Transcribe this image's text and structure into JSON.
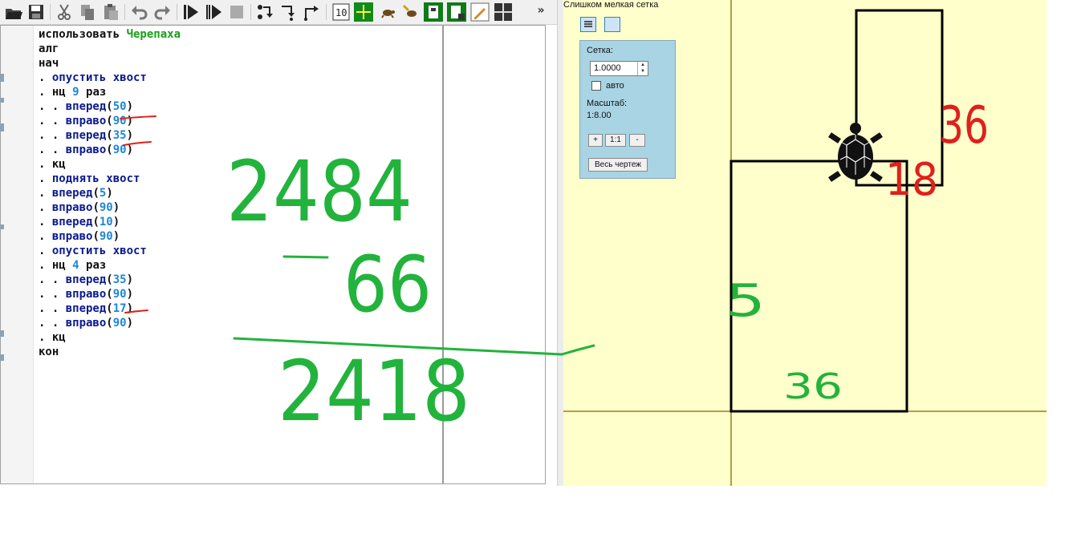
{
  "toolbar": {
    "buttons": [
      "open-icon",
      "save-icon",
      "cut-icon",
      "copy-icon",
      "paste-icon",
      "undo-icon",
      "redo-icon",
      "run-icon",
      "run-step-icon",
      "stop-icon",
      "step-over-icon",
      "step-into-icon",
      "step-out-icon",
      "grid-10-icon",
      "turtle-target-icon",
      "turtle-icon",
      "turtle-pen-icon",
      "save-drawing-icon",
      "save-drawing-green-icon",
      "pencil-tool-icon",
      "checker-icon"
    ],
    "overflow_label": "»"
  },
  "code_lines": [
    [
      {
        "t": "использовать ",
        "c": ""
      },
      {
        "t": "Черепаха",
        "c": "mod"
      }
    ],
    [
      {
        "t": "алг",
        "c": ""
      }
    ],
    [
      {
        "t": "нач",
        "c": ""
      }
    ],
    [
      {
        "t": ". ",
        "c": ""
      },
      {
        "t": "опустить хвост",
        "c": "kw"
      }
    ],
    [
      {
        "t": ". нц ",
        "c": ""
      },
      {
        "t": "9",
        "c": "num"
      },
      {
        "t": " раз",
        "c": ""
      }
    ],
    [
      {
        "t": ". . ",
        "c": ""
      },
      {
        "t": "вперед",
        "c": "kw"
      },
      {
        "t": "(",
        "c": ""
      },
      {
        "t": "50",
        "c": "num"
      },
      {
        "t": ")",
        "c": ""
      }
    ],
    [
      {
        "t": ". . ",
        "c": ""
      },
      {
        "t": "вправо",
        "c": "kw"
      },
      {
        "t": "(",
        "c": ""
      },
      {
        "t": "90",
        "c": "num"
      },
      {
        "t": ")",
        "c": ""
      }
    ],
    [
      {
        "t": ". . ",
        "c": ""
      },
      {
        "t": "вперед",
        "c": "kw"
      },
      {
        "t": "(",
        "c": ""
      },
      {
        "t": "35",
        "c": "num"
      },
      {
        "t": ")",
        "c": ""
      }
    ],
    [
      {
        "t": ". . ",
        "c": ""
      },
      {
        "t": "вправо",
        "c": "kw"
      },
      {
        "t": "(",
        "c": ""
      },
      {
        "t": "90",
        "c": "num"
      },
      {
        "t": ")",
        "c": ""
      }
    ],
    [
      {
        "t": ". кц",
        "c": ""
      }
    ],
    [
      {
        "t": ". ",
        "c": ""
      },
      {
        "t": "поднять хвост",
        "c": "kw"
      }
    ],
    [
      {
        "t": ". ",
        "c": ""
      },
      {
        "t": "вперед",
        "c": "kw"
      },
      {
        "t": "(",
        "c": ""
      },
      {
        "t": "5",
        "c": "num"
      },
      {
        "t": ")",
        "c": ""
      }
    ],
    [
      {
        "t": ". ",
        "c": ""
      },
      {
        "t": "вправо",
        "c": "kw"
      },
      {
        "t": "(",
        "c": ""
      },
      {
        "t": "90",
        "c": "num"
      },
      {
        "t": ")",
        "c": ""
      }
    ],
    [
      {
        "t": ". ",
        "c": ""
      },
      {
        "t": "вперед",
        "c": "kw"
      },
      {
        "t": "(",
        "c": ""
      },
      {
        "t": "10",
        "c": "num"
      },
      {
        "t": ")",
        "c": ""
      }
    ],
    [
      {
        "t": ". ",
        "c": ""
      },
      {
        "t": "вправо",
        "c": "kw"
      },
      {
        "t": "(",
        "c": ""
      },
      {
        "t": "90",
        "c": "num"
      },
      {
        "t": ")",
        "c": ""
      }
    ],
    [
      {
        "t": ". ",
        "c": ""
      },
      {
        "t": "опустить хвост",
        "c": "kw"
      }
    ],
    [
      {
        "t": ". нц ",
        "c": ""
      },
      {
        "t": "4",
        "c": "num"
      },
      {
        "t": " раз",
        "c": ""
      }
    ],
    [
      {
        "t": ". . ",
        "c": ""
      },
      {
        "t": "вперед",
        "c": "kw"
      },
      {
        "t": "(",
        "c": ""
      },
      {
        "t": "35",
        "c": "num"
      },
      {
        "t": ")",
        "c": ""
      }
    ],
    [
      {
        "t": ". . ",
        "c": ""
      },
      {
        "t": "вправо",
        "c": "kw"
      },
      {
        "t": "(",
        "c": ""
      },
      {
        "t": "90",
        "c": "num"
      },
      {
        "t": ")",
        "c": ""
      }
    ],
    [
      {
        "t": ". . ",
        "c": ""
      },
      {
        "t": "вперед",
        "c": "kw"
      },
      {
        "t": "(",
        "c": ""
      },
      {
        "t": "17",
        "c": "num"
      },
      {
        "t": ")",
        "c": ""
      }
    ],
    [
      {
        "t": ". . ",
        "c": ""
      },
      {
        "t": "вправо",
        "c": "kw"
      },
      {
        "t": "(",
        "c": ""
      },
      {
        "t": "90",
        "c": "num"
      },
      {
        "t": ")",
        "c": ""
      }
    ],
    [
      {
        "t": ". кц",
        "c": ""
      }
    ],
    [
      {
        "t": "кон",
        "c": ""
      }
    ]
  ],
  "canvas": {
    "warning": "Слишком мелкая сетка",
    "panel": {
      "grid_label": "Сетка:",
      "grid_value": "1.0000",
      "auto_label": "авто",
      "auto_checked": false,
      "scale_label": "Масштаб:",
      "scale_value": "1:8.00",
      "zoom_in": "+",
      "zoom_reset": "1:1",
      "zoom_out": "-",
      "fit_all": "Весь чертеж"
    }
  },
  "annotations": {
    "sum_top": "2484",
    "sum_minus": "66",
    "sum_result": "2418",
    "label_36_red": "36",
    "label_18_red": "18",
    "label_5_green": "5",
    "label_36_green": "36"
  },
  "colors": {
    "keyword": "#0a1a8c",
    "number": "#1e87d6",
    "module": "#16a016",
    "canvas_bg": "#ffffcc",
    "panel_bg": "#a9d4e4",
    "ink_green": "#22b33c",
    "ink_red": "#e0201c"
  }
}
